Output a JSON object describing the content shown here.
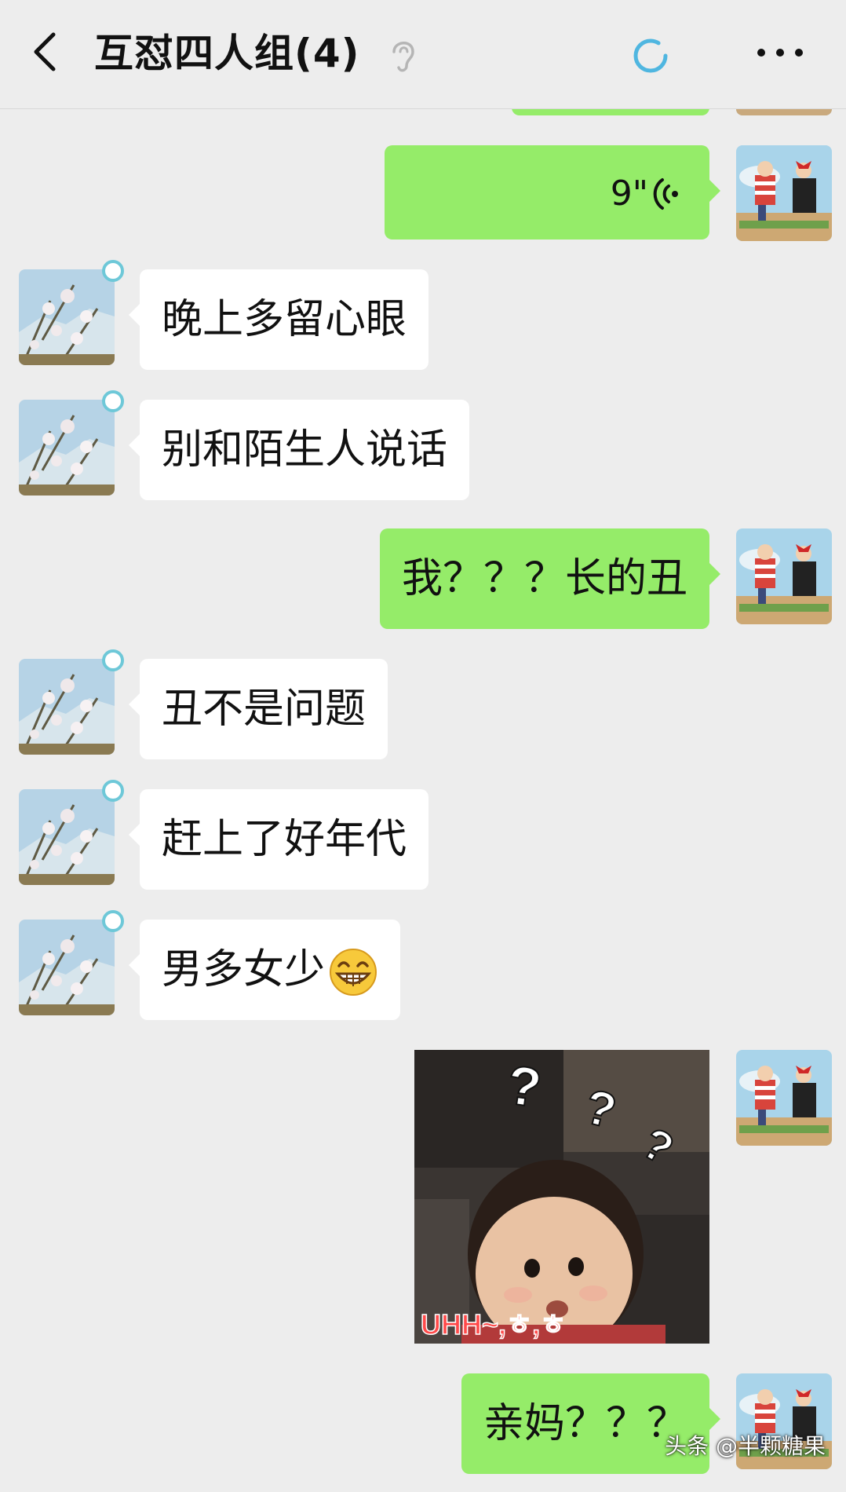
{
  "header": {
    "title": "互怼四人组(4)",
    "back_icon": "chevron-left-icon",
    "mute_icon": "ear-icon",
    "status_icon": "loading-icon",
    "more_icon": "more-horizontal-icon"
  },
  "messages": [
    {
      "side": "right",
      "type": "voice",
      "duration": "9\""
    },
    {
      "side": "left",
      "type": "text",
      "text": "晚上多留心眼"
    },
    {
      "side": "left",
      "type": "text",
      "text": "别和陌生人说话"
    },
    {
      "side": "right",
      "type": "text",
      "text": "我？？？长的丑"
    },
    {
      "side": "left",
      "type": "text",
      "text": "丑不是问题"
    },
    {
      "side": "left",
      "type": "text",
      "text": "赶上了好年代"
    },
    {
      "side": "left",
      "type": "text",
      "text": "男多女少",
      "emoji": "grin-emoji"
    },
    {
      "side": "right",
      "type": "sticker",
      "sticker": {
        "marks": [
          "?",
          "?",
          "?"
        ],
        "caption": "UHH~,ㅎ,ㅎ"
      }
    },
    {
      "side": "right",
      "type": "text",
      "text": "亲妈？？？"
    }
  ],
  "watermark": "头条 @半颗糖果",
  "colors": {
    "background": "#ededed",
    "bubble_right": "#95ec69",
    "bubble_left": "#ffffff",
    "badge": "#6ec8d8"
  }
}
